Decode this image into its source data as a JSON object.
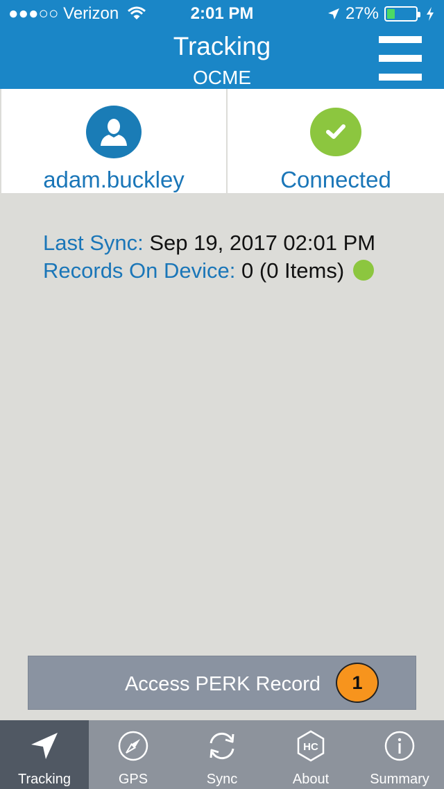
{
  "status_bar": {
    "carrier": "●●●○○ Verizon",
    "time": "2:01 PM",
    "battery": "27%",
    "battery_level": 0.27
  },
  "header": {
    "title": "Tracking",
    "subtitle": "OCME"
  },
  "tiles": {
    "user_label": "adam.buckley",
    "connection_label": "Connected"
  },
  "info": {
    "last_sync_label": "Last Sync:",
    "last_sync_value": "Sep 19, 2017 02:01 PM",
    "records_label": "Records On Device:",
    "records_value": "0 (0 Items)"
  },
  "perk": {
    "label": "Access PERK Record",
    "badge": "1"
  },
  "tabs": [
    {
      "label": "Tracking",
      "icon": "navigation-arrow-icon",
      "active": true
    },
    {
      "label": "GPS",
      "icon": "compass-icon",
      "active": false
    },
    {
      "label": "Sync",
      "icon": "sync-icon",
      "active": false
    },
    {
      "label": "About",
      "icon": "hc-logo-icon",
      "active": false
    },
    {
      "label": "Summary",
      "icon": "info-icon",
      "active": false
    }
  ],
  "colors": {
    "primary": "#1a86c7",
    "success": "#8cc63f",
    "badge": "#f7941d",
    "tab_bar": "#8d939c",
    "tab_active": "#505863"
  }
}
